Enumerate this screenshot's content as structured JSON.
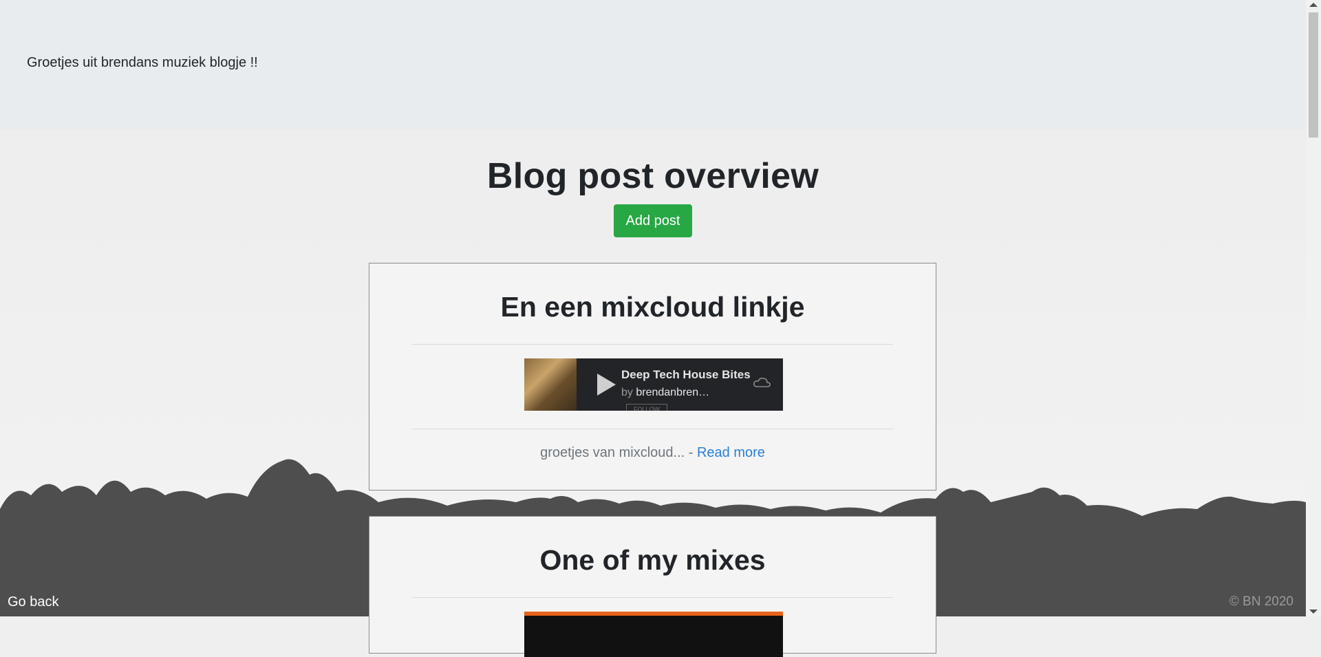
{
  "header": {
    "text": "Groetjes uit brendans muziek blogje !!"
  },
  "main": {
    "title": "Blog post overview",
    "add_post_label": "Add post"
  },
  "posts": [
    {
      "title": "En een mixcloud linkje",
      "player": {
        "show_title": "Deep Tech House Bites",
        "by_label": "by",
        "owner": "brendanbren…",
        "follow_label": "FOLLOW"
      },
      "excerpt": "groetjes van mixcloud...",
      "separator": " - ",
      "read_more_label": "Read more"
    },
    {
      "title": "One of my mixes"
    }
  ],
  "footer": {
    "go_back_label": "Go back",
    "copyright": "© BN 2020"
  },
  "colors": {
    "accent_green": "#28a745",
    "link_blue": "#2a7fd4",
    "header_bg": "#e9ecef"
  }
}
